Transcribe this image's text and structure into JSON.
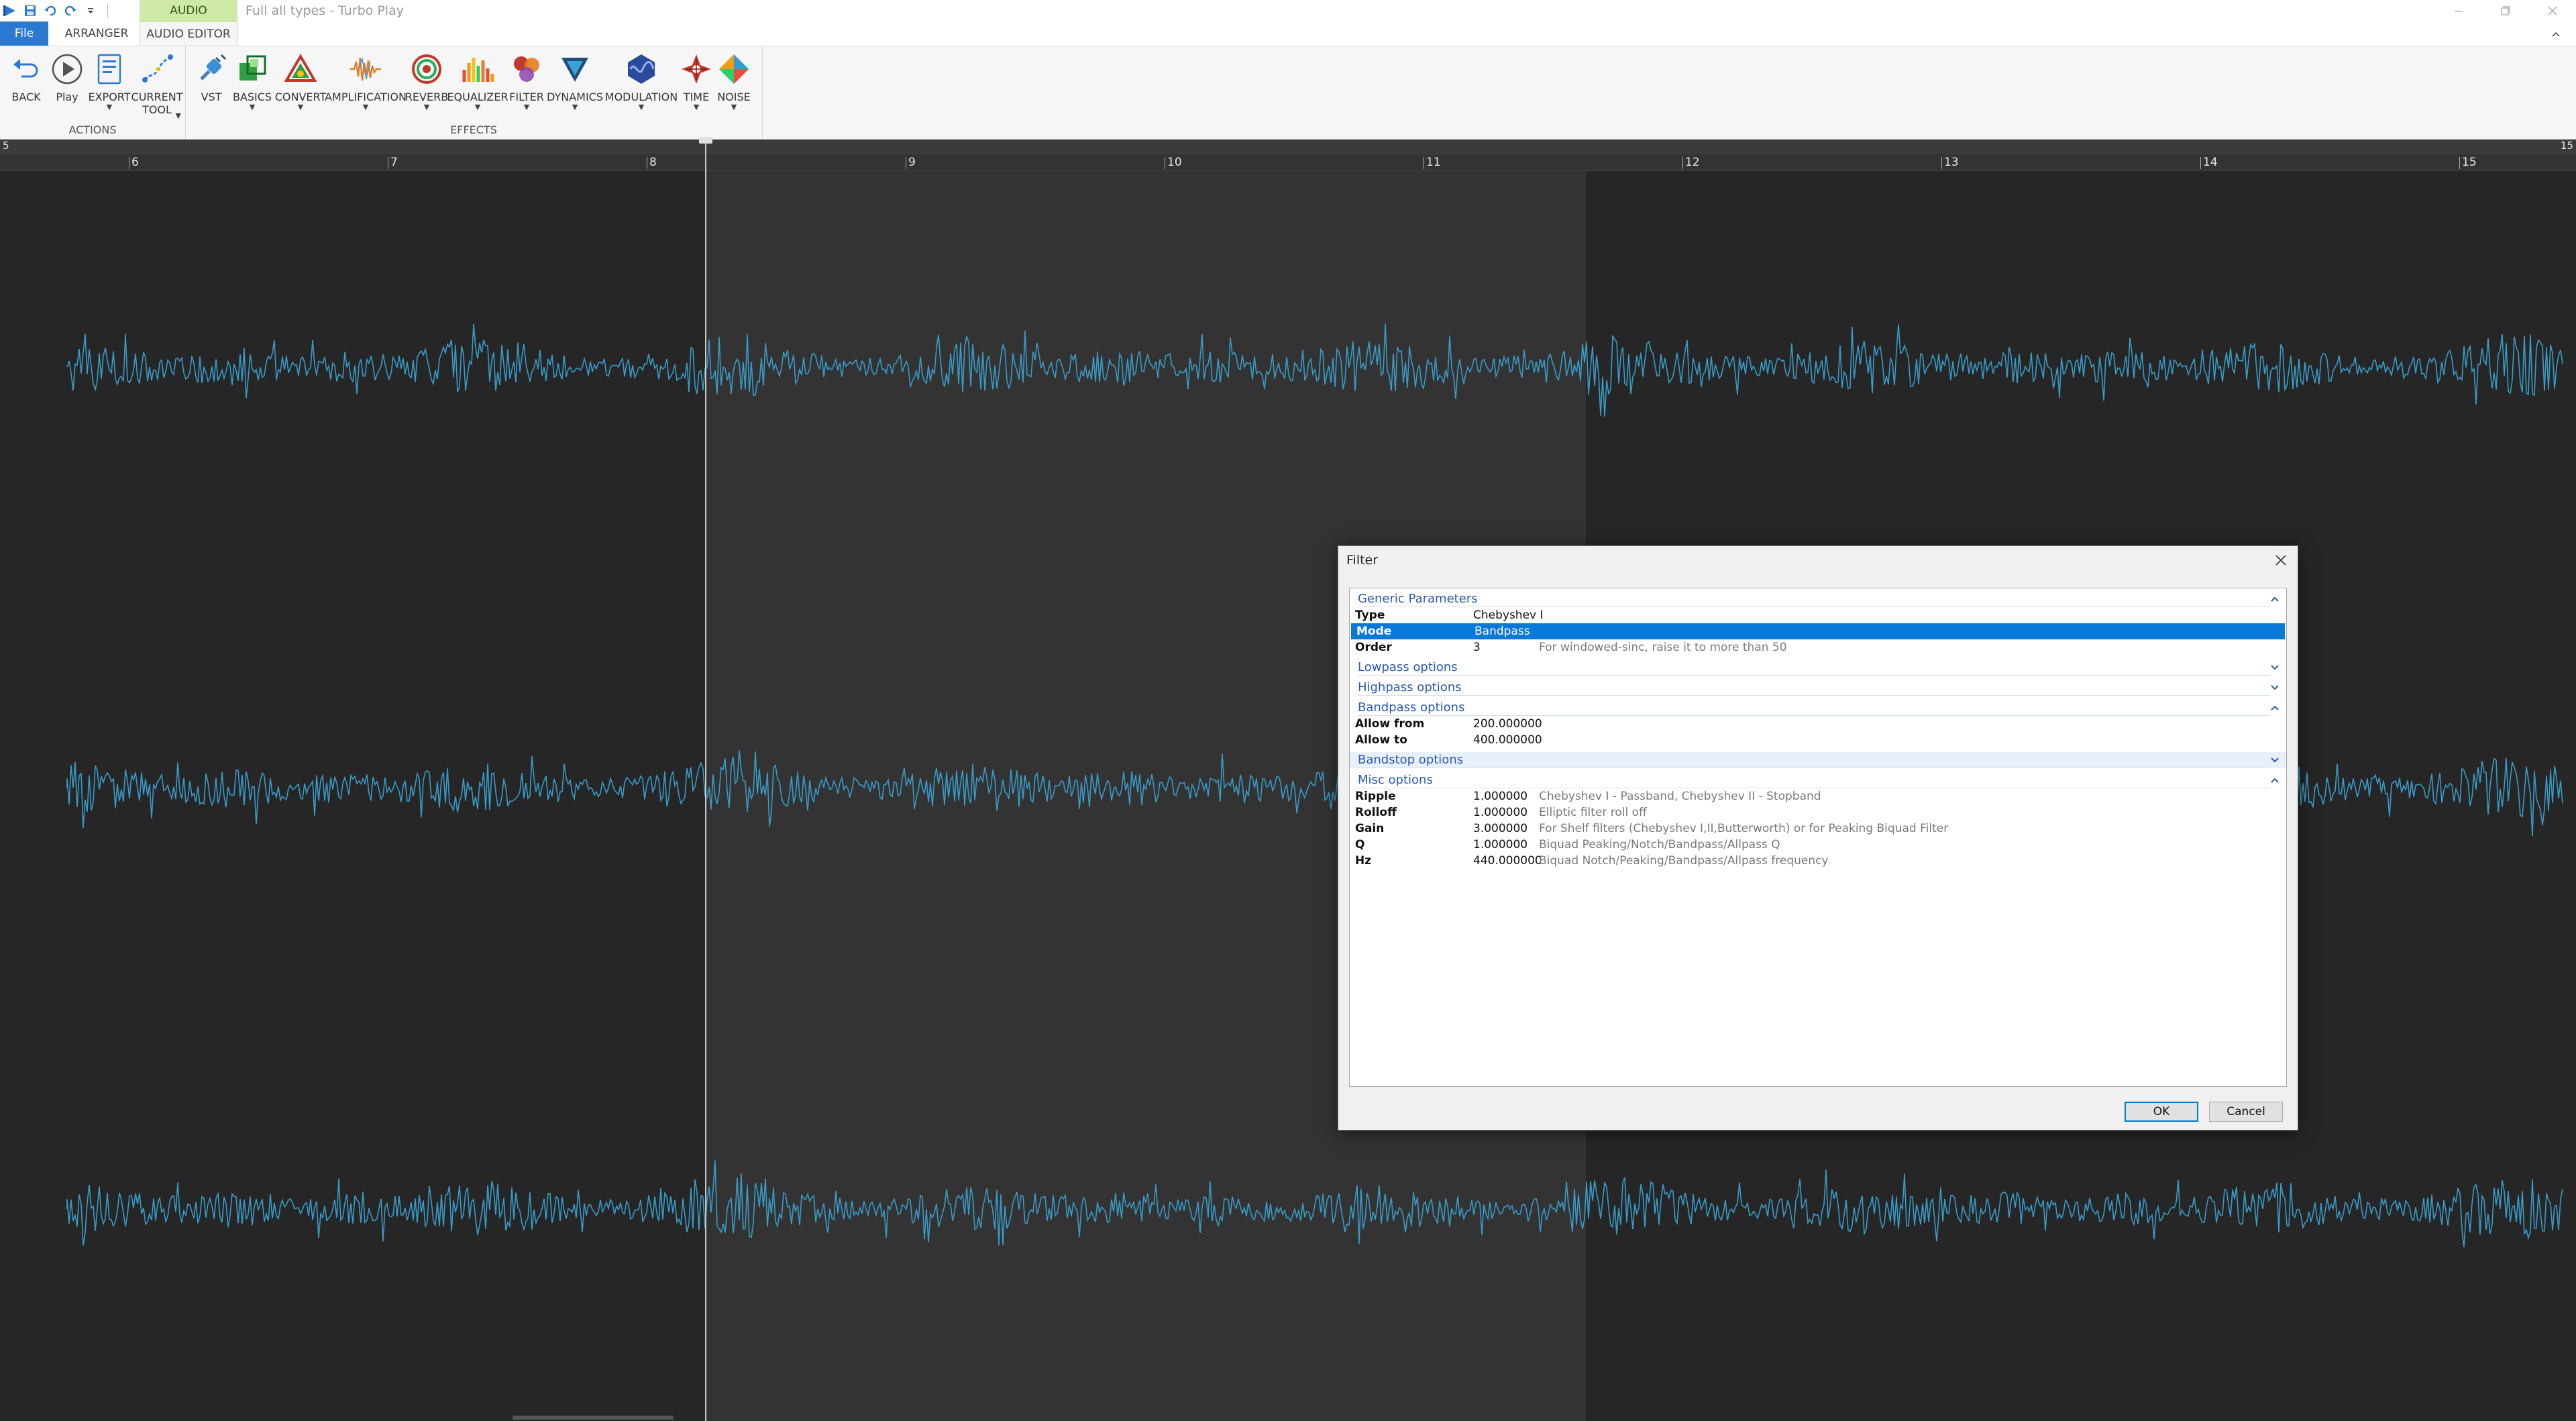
{
  "window": {
    "context_tab": "AUDIO",
    "title": "Full all types - Turbo Play"
  },
  "tabs": {
    "file": "File",
    "arranger": "ARRANGER",
    "audio_editor": "AUDIO EDITOR"
  },
  "ribbon": {
    "actions": {
      "label": "ACTIONS",
      "back": "BACK",
      "play": "Play",
      "export": "EXPORT",
      "current_tool_line1": "CURRENT",
      "current_tool_line2": "TOOL"
    },
    "effects": {
      "label": "EFFECTS",
      "vst": "VST",
      "basics": "BASICS",
      "convert": "CONVERT",
      "amplification": "AMPLIFICATION",
      "reverb": "REVERB",
      "equalizer": "EQUALIZER",
      "filter": "FILTER",
      "dynamics": "DYNAMICS",
      "modulation": "MODULATION",
      "time": "TIME",
      "noise": "NOISE"
    }
  },
  "ruler": {
    "start_label": "5",
    "end_label": "15",
    "ticks": [
      "6",
      "7",
      "8",
      "9",
      "10",
      "11",
      "12",
      "13",
      "14",
      "15"
    ]
  },
  "dialog": {
    "title": "Filter",
    "sections": {
      "generic": "Generic Parameters",
      "lowpass": "Lowpass options",
      "highpass": "Highpass options",
      "bandpass": "Bandpass options",
      "bandstop": "Bandstop options",
      "misc": "Misc options"
    },
    "generic": {
      "type": {
        "name": "Type",
        "value": "Chebyshev I"
      },
      "mode": {
        "name": "Mode",
        "value": "Bandpass"
      },
      "order": {
        "name": "Order",
        "value": "3",
        "desc": "For windowed-sinc, raise it to more than 50"
      }
    },
    "bandpass": {
      "allow_from": {
        "name": "Allow from",
        "value": "200.000000"
      },
      "allow_to": {
        "name": "Allow to",
        "value": "400.000000"
      }
    },
    "misc": {
      "ripple": {
        "name": "Ripple",
        "value": "1.000000",
        "desc": "Chebyshev I - Passband, Chebyshev II - Stopband"
      },
      "rolloff": {
        "name": "Rolloff",
        "value": "1.000000",
        "desc": "Elliptic filter roll off"
      },
      "gain": {
        "name": "Gain",
        "value": "3.000000",
        "desc": "For Shelf filters (Chebyshev I,II,Butterworth) or for Peaking Biquad Filter"
      },
      "q": {
        "name": "Q",
        "value": "1.000000",
        "desc": "Biquad Peaking/Notch/Bandpass/Allpass Q"
      },
      "hz": {
        "name": "Hz",
        "value": "440.000000",
        "desc": "Biquad Notch/Peaking/Bandpass/Allpass frequency"
      }
    },
    "ok_label": "OK",
    "cancel_label": "Cancel"
  },
  "colors": {
    "waveform": "#3a9bc7",
    "accent": "#0a78d7",
    "context_tab": "#cfe9a8"
  }
}
